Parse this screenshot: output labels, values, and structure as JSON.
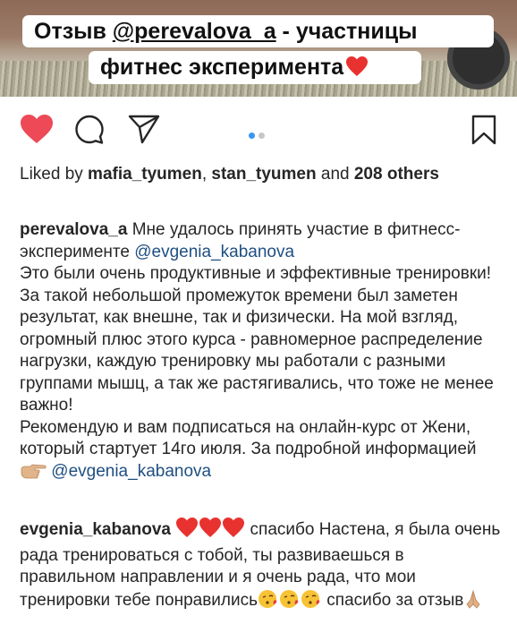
{
  "banner": {
    "line1_prefix": "Отзыв ",
    "line1_mention": "@perevalova_a",
    "line1_suffix": " - участницы",
    "line2": "фитнес эксперимента"
  },
  "icons": {
    "like": "heart-filled-icon",
    "comment": "comment-bubble-icon",
    "share": "paper-plane-icon",
    "save": "bookmark-icon"
  },
  "colors": {
    "like": "#ed4956",
    "link": "#1e4f82",
    "dot_active": "#3897f0",
    "dot_inactive": "#c7c7c7"
  },
  "likes": {
    "prefix": "Liked by ",
    "user1": "mafia_tyumen",
    "separator": ", ",
    "user2": "stan_tyumen",
    "and_text": " and ",
    "others": "208 others"
  },
  "caption": {
    "username": "perevalova_a",
    "line1": " Мне удалось принять участие в фитнесс-эксперименте ",
    "mention1": "@evgenia_kabanova",
    "para2": "Это были очень продуктивные и эффективные тренировки! За такой небольшой промежуток времени был заметен результат, как внешне, так и физически. На мой взгляд, огромный плюс этого курса - равномерное распределение нагрузки, каждую тренировку мы работали с разными группами мышц, а так же растягивались, что тоже не менее важно!",
    "para3": "Рекомендую и вам подписаться на онлайн-курс от Жени, который стартует 14го июля. За подробной информацией ",
    "mention2": "@evgenia_kabanova"
  },
  "comment": {
    "username": "evgenia_kabanova",
    "text1": " спасибо Настена, я была очень рада тренироваться с тобой, ты развиваешься в правильном направлении и я очень рада, что мои тренировки тебе понравились",
    "text2": " спасибо за отзыв"
  },
  "emojis": {
    "banner": "red-heart",
    "pointing": "backhand-index-pointing-right",
    "hearts": [
      "red-heart",
      "red-heart",
      "red-heart"
    ],
    "kisses": [
      "face-blowing-a-kiss",
      "face-blowing-a-kiss",
      "face-blowing-a-kiss"
    ],
    "thanks": "folded-hands"
  }
}
